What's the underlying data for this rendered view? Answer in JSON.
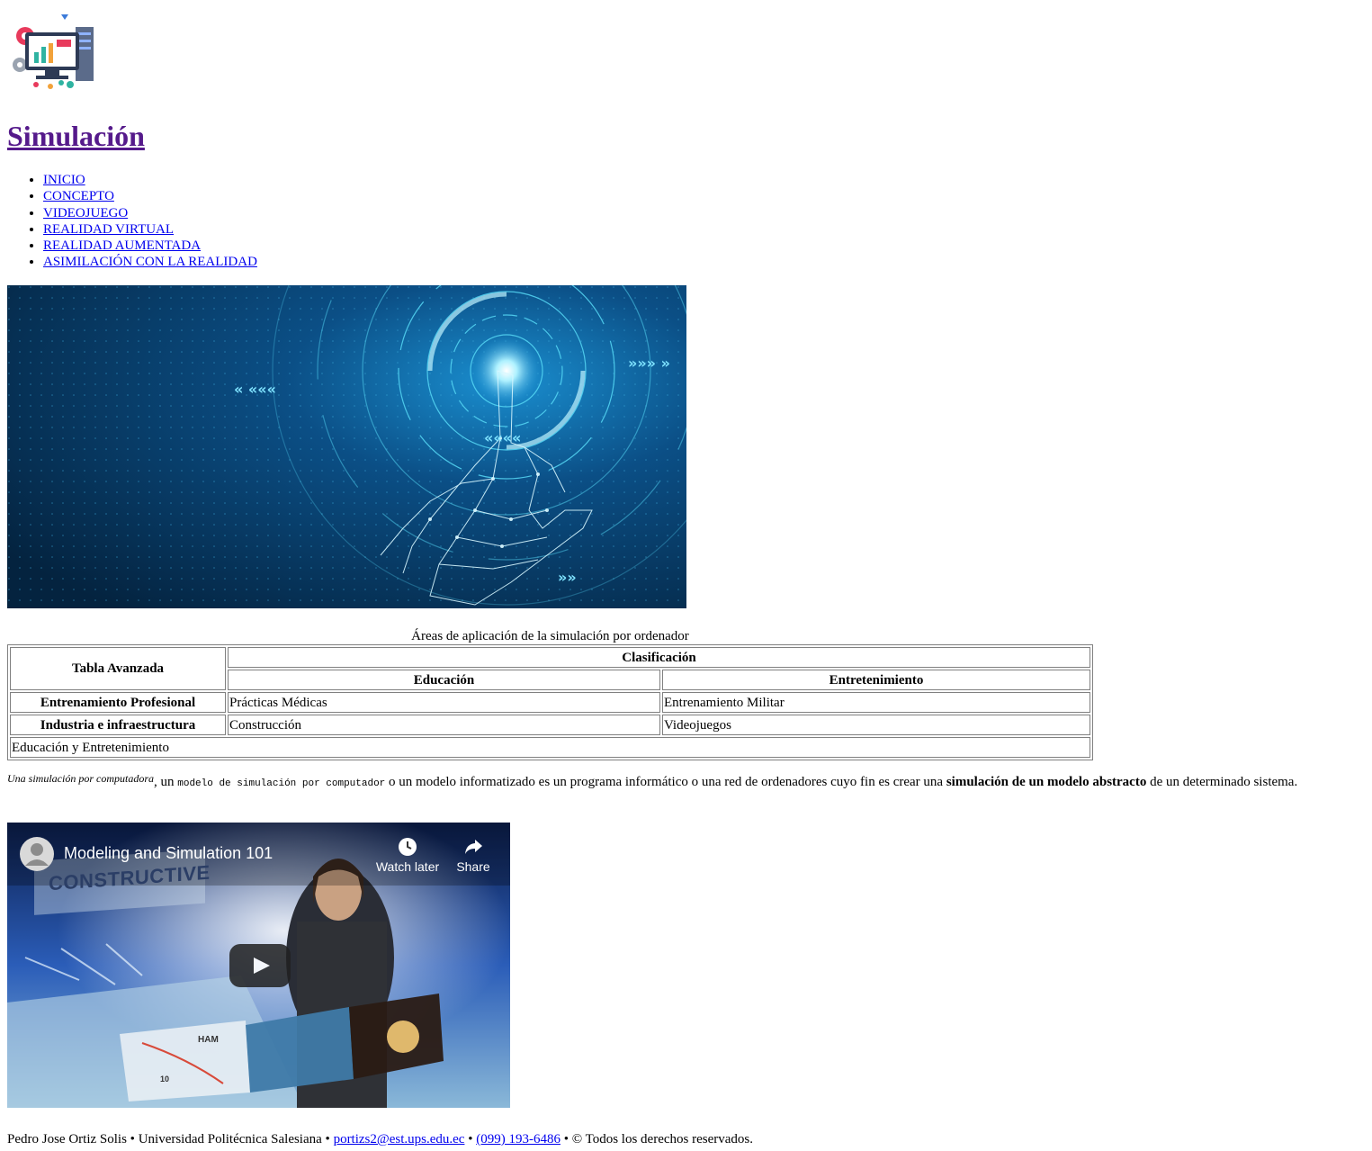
{
  "logo": {
    "alt": "logo-icon"
  },
  "site": {
    "title": "Simulación"
  },
  "nav": {
    "items": [
      {
        "label": "INICIO"
      },
      {
        "label": "CONCEPTO"
      },
      {
        "label": "VIDEOJUEGO"
      },
      {
        "label": "REALIDAD VIRTUAL"
      },
      {
        "label": "REALIDAD AUMENTADA"
      },
      {
        "label": "ASIMILACIÓN CON LA REALIDAD"
      }
    ]
  },
  "table": {
    "caption": "Áreas de aplicación de la simulación por ordenador",
    "corner": "Tabla Avanzada",
    "group_header": "Clasificación",
    "col_headers": [
      "Educación",
      "Entretenimiento"
    ],
    "rows": [
      {
        "header": "Entrenamiento Profesional",
        "cells": [
          "Prácticas Médicas",
          "Entrenamiento Militar"
        ]
      },
      {
        "header": "Industria e infraestructura",
        "cells": [
          "Construcción",
          "Videojuegos"
        ]
      }
    ],
    "footer": "Educación y Entretenimiento"
  },
  "paragraph": {
    "italic": "Una simulación por computadora",
    "t1": ", un ",
    "code": "modelo de simulación por computador",
    "t2": " o un modelo informatizado es un programa informático o una red de ordenadores cuyo fin es crear una ",
    "bold": "simulación de un modelo abstracto",
    "t3": " de un determinado sistema."
  },
  "video": {
    "title": "Modeling and Simulation 101",
    "watch_later": "Watch later",
    "share": "Share",
    "overlay_word": "CONSTRUCTIVE",
    "map_label": "HAM",
    "map_route": "10"
  },
  "footer": {
    "author": "Pedro Jose Ortiz Solis",
    "sep": " • ",
    "university": "Universidad Politécnica Salesiana",
    "email": "portizs2@est.ups.edu.ec",
    "phone": "(099) 193-6486",
    "rights": "© Todos los derechos reservados."
  }
}
